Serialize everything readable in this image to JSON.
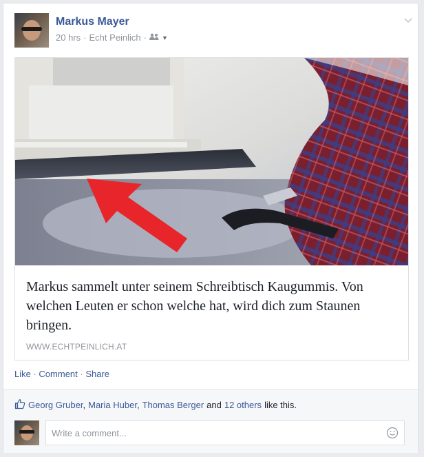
{
  "post": {
    "author": "Markus Mayer",
    "time": "20 hrs",
    "separator": "·",
    "page": "Echt Peinlich",
    "audience_icon": "friends-icon"
  },
  "link": {
    "title": "Markus sammelt unter seinem Schreibtisch Kaugummis. Von welchen Leuten er schon welche hat, wird dich zum Staunen bringen.",
    "domain": "WWW.ECHTPEINLICH.AT"
  },
  "actions": {
    "like": "Like",
    "comment": "Comment",
    "share": "Share",
    "sep": " · "
  },
  "likes": {
    "person1": "Georg Gruber",
    "person2": "Maria Huber",
    "person3": "Thomas Berger",
    "comma": ",",
    "and": "and",
    "others": "12 others",
    "suffix": "like this."
  },
  "comment": {
    "placeholder": "Write a comment..."
  },
  "colors": {
    "link_blue": "#3b5998",
    "meta_gray": "#90949c",
    "arrow_red": "#e8252a"
  }
}
